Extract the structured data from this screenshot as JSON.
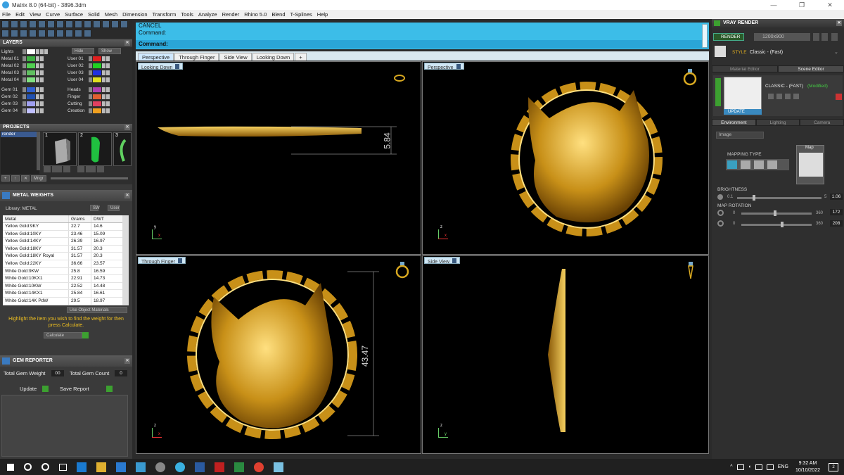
{
  "window": {
    "title": "Matrix 8.0 (64-bit) - 3896.3dm",
    "controls": [
      "—",
      "❐",
      "✕"
    ]
  },
  "menu": [
    "File",
    "Edit",
    "View",
    "Curve",
    "Surface",
    "Solid",
    "Mesh",
    "Dimension",
    "Transform",
    "Tools",
    "Analyze",
    "Render",
    "Rhino 5.0",
    "Blend",
    "T-Splines",
    "Help"
  ],
  "layers": {
    "title": "LAYERS",
    "lights_label": "Lights",
    "hide_label": "Hide",
    "show_label": "Show",
    "left": [
      {
        "name": "Metal 01",
        "color": "#3cb040"
      },
      {
        "name": "Metal 02",
        "color": "#50d050"
      },
      {
        "name": "Metal 03",
        "color": "#60c060"
      },
      {
        "name": "Metal 04",
        "color": "#80e080"
      },
      {
        "name": "Gem 01",
        "color": "#3060d0"
      },
      {
        "name": "Gem 02",
        "color": "#2050b0"
      },
      {
        "name": "Gem 03",
        "color": "#a0a0f0"
      },
      {
        "name": "Gem 04",
        "color": "#c0c0ff"
      }
    ],
    "right": [
      {
        "name": "User 01",
        "color": "#e02020"
      },
      {
        "name": "User 02",
        "color": "#20d020"
      },
      {
        "name": "User 03",
        "color": "#2030e0"
      },
      {
        "name": "User 04",
        "color": "#e0e020"
      },
      {
        "name": "Heads",
        "color": "#b040b0"
      },
      {
        "name": "Finger",
        "color": "#e06030"
      },
      {
        "name": "Cutting",
        "color": "#e04060"
      },
      {
        "name": "Creation",
        "color": "#f0a020"
      }
    ]
  },
  "projects": {
    "title": "PROJECTS",
    "selected": "render",
    "thumb_numbers": [
      "1",
      "2",
      "3"
    ],
    "mngr_label": "Mngr"
  },
  "metal_weights": {
    "title": "METAL WEIGHTS",
    "library_label": "Library: METAL",
    "sw_label": "SW",
    "user_label": "User",
    "columns": [
      "Metal",
      "Grams",
      "DWT"
    ],
    "rows": [
      [
        "Yellow Gold:9KY",
        "22.7",
        "14.6"
      ],
      [
        "Yellow Gold:10KY",
        "23.46",
        "15.09"
      ],
      [
        "Yellow Gold:14KY",
        "26.39",
        "16.97"
      ],
      [
        "Yellow Gold:18KY",
        "31.57",
        "20.3"
      ],
      [
        "Yellow Gold:18KY Royal",
        "31.57",
        "20.3"
      ],
      [
        "Yellow Gold:22KY",
        "36.66",
        "23.57"
      ],
      [
        "White Gold:9KW",
        "25.8",
        "16.59"
      ],
      [
        "White Gold:10KX1",
        "22.91",
        "14.73"
      ],
      [
        "White Gold:10KW",
        "22.52",
        "14.48"
      ],
      [
        "White Gold:14KX1",
        "25.84",
        "16.61"
      ],
      [
        "White Gold:14K PdW",
        "29.5",
        "18.97"
      ]
    ],
    "use_object_materials": "Use Object Materials",
    "hint": "Highlight the item you wish to find the weight for then press Calculate.",
    "calculate": "Calculate"
  },
  "gem_reporter": {
    "title": "GEM REPORTER",
    "total_weight_label": "Total Gem Weight",
    "total_weight_value": "00",
    "total_count_label": "Total Gem Count",
    "total_count_value": "0",
    "update": "Update",
    "save_report": "Save Report"
  },
  "command": {
    "line1": "CANCEL",
    "line2": "Command:",
    "prompt": "Command:"
  },
  "tabs": [
    "Perspective",
    "Through Finger",
    "Side View",
    "Looking Down",
    "+"
  ],
  "viewports": {
    "top_left": {
      "label": "Looking Down",
      "dimension": "5.84",
      "axis_v": "y",
      "axis_h": "x"
    },
    "top_right": {
      "label": "Perspective",
      "axis_v": "z",
      "axis_h": "x"
    },
    "bottom_left": {
      "label": "Through Finger",
      "dimension": "43.47",
      "axis_v": "z",
      "axis_h": "x"
    },
    "bottom_right": {
      "label": "Side View",
      "axis_v": "z",
      "axis_h": "y"
    }
  },
  "vray": {
    "title": "VRAY RENDER",
    "render_btn": "RENDER",
    "resolution": "1200x900",
    "style_label": "STYLE",
    "style_value": "Classic - (Fast)",
    "tab_material": "Material Editor",
    "tab_scene": "Scene Editor",
    "preset_name": "CLASSIC - (FAST)",
    "preset_state": "(Modified)",
    "update": "UPDATE",
    "env_tabs": [
      "Environment",
      "Lighting",
      "Camera"
    ],
    "env_type": "Image",
    "mapping_type": "MAPPING TYPE",
    "map_label": "Map",
    "brightness_label": "BRIGHTNESS",
    "brightness_min": "0.1",
    "brightness_max": "5",
    "brightness_value": "1.06",
    "brightness_fraction": 0.2,
    "map_rotation_label": "MAP ROTATION",
    "rot1_min": "0",
    "rot1_max": "360",
    "rot1_value": "172",
    "rot1_fraction": 0.48,
    "rot2_min": "0",
    "rot2_max": "360",
    "rot2_value": "208",
    "rot2_fraction": 0.58
  },
  "taskbar": {
    "lang": "ENG",
    "time": "9:32 AM",
    "date": "10/10/2022",
    "notifications": "2"
  },
  "colors": {
    "gold": "#d8a820",
    "command_bg": "#3cbde8",
    "accent_green": "#3ca030"
  }
}
